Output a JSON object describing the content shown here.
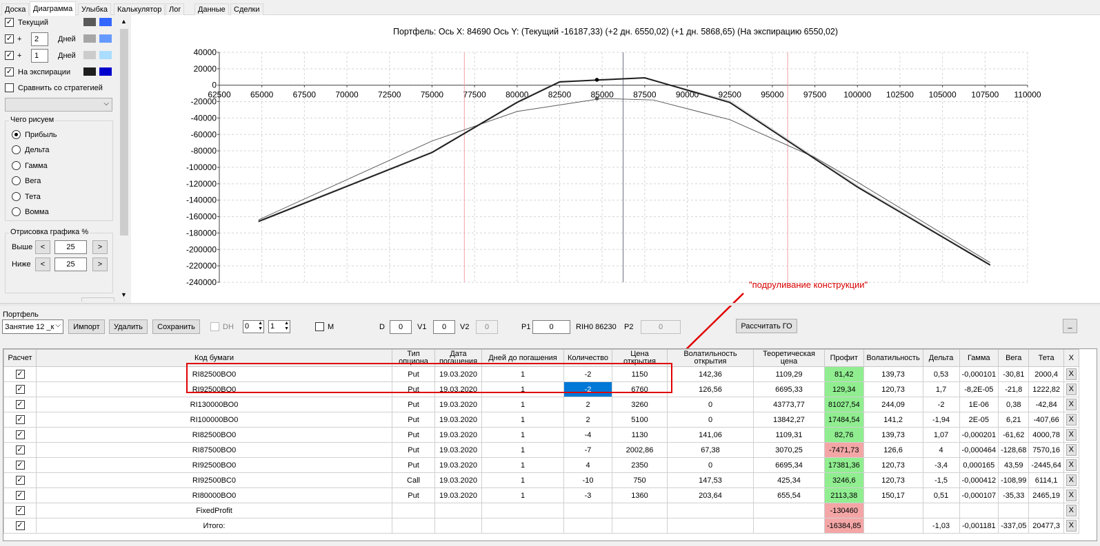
{
  "tabs": [
    "Доска",
    "Диаграмма",
    "Улыбка",
    "Калькулятор",
    "Лог",
    "Данные",
    "Сделки"
  ],
  "active_tab": "Диаграмма",
  "left": {
    "current_label": "Текущий",
    "plus": "+",
    "days": "Дней",
    "days1": "2",
    "days2": "1",
    "expiry_label": "На экспирации",
    "compare_label": "Сравнить со стратегией",
    "compare_select": "",
    "what_group": "Чего рисуем",
    "options": [
      "Прибыль",
      "Дельта",
      "Гамма",
      "Вега",
      "Тета",
      "Вомма"
    ],
    "selected_option": "Прибыль",
    "draw_group": "Отрисовка графика %",
    "above_label": "Выше",
    "below_label": "Ниже",
    "above_value": "25",
    "below_value": "25",
    "lt": "<",
    "gt": ">",
    "colors": {
      "current": [
        "#595959",
        "#3366ff"
      ],
      "plus2": [
        "#a6a6a6",
        "#6699ff"
      ],
      "plus1": [
        "#cccccc",
        "#aaddff"
      ],
      "expiry": [
        "#1f1f1f",
        "#0000cc"
      ]
    }
  },
  "chart": {
    "title": "Портфель: Ось X: 84690 Ось Y:  (Текущий -16187,33)  (+2 дн. 6550,02)  (+1 дн. 5868,65)  (На экспирацию 6550,02)",
    "annotation": "\"подруливание конструкции\""
  },
  "chart_data": {
    "type": "line",
    "xlim": [
      62500,
      110000
    ],
    "ylim": [
      -240000,
      40000
    ],
    "x_ticks": [
      62500,
      65000,
      67500,
      70000,
      72500,
      75000,
      77500,
      80000,
      82500,
      85000,
      87500,
      90000,
      92500,
      95000,
      97500,
      100000,
      102500,
      105000,
      107500,
      110000
    ],
    "x_tick_labels": [
      "62500",
      "65000",
      "67500",
      "70000",
      "72500",
      "75000",
      "77500",
      "80000",
      "82500",
      "85000",
      "87500",
      "90000",
      "92500",
      "95000",
      "97500",
      "100000",
      "102500",
      "105000",
      "107500",
      "110000"
    ],
    "y_ticks": [
      40000,
      20000,
      0,
      -20000,
      -40000,
      -60000,
      -80000,
      -100000,
      -120000,
      -140000,
      -160000,
      -180000,
      -200000,
      -220000,
      -240000
    ],
    "y_tick_labels": [
      "40000",
      "20000",
      "0",
      "-20000",
      "-40000",
      "-60000",
      "-80000",
      "-100000",
      "-120000",
      "-140000",
      "-160000",
      "-180000",
      "-200000",
      "-220000",
      "-240000"
    ],
    "vlines": {
      "current_x": 84690,
      "center": 86230,
      "lower_bound": 76900,
      "upper_bound": 95900
    },
    "series": [
      {
        "color": "#1f1f1f",
        "x": [
          64800,
          75000,
          80000,
          82500,
          85000,
          87500,
          92500,
          100000,
          107800
        ],
        "y": [
          -166000,
          -82000,
          -21000,
          4000,
          6550,
          9000,
          -21000,
          -124000,
          -219000
        ]
      },
      {
        "color": "#595959",
        "x": [
          64800,
          70000,
          75000,
          80000,
          85000,
          88000,
          92500,
          97500,
          100000,
          107800
        ],
        "y": [
          -164000,
          -115000,
          -68000,
          -32000,
          -16187,
          -18000,
          -42000,
          -88000,
          -118000,
          -216000
        ]
      },
      {
        "color": "#cccccc",
        "x": [
          64800,
          75000,
          80000,
          82500,
          85000,
          87500,
          92500,
          100000,
          107800
        ],
        "y": [
          -165000,
          -81000,
          -20000,
          5000,
          5868,
          8500,
          -19000,
          -122000,
          -218000
        ]
      }
    ],
    "markers": [
      {
        "x": 84690,
        "y": 6550
      },
      {
        "x": 84690,
        "y": -16187
      }
    ]
  },
  "toolbar": {
    "portfolio_label": "Портфель",
    "session": "Занятие 12 _к",
    "import": "Импорт",
    "delete": "Удалить",
    "save": "Сохранить",
    "dh": "DH",
    "dh_v1": "0",
    "dh_v2": "1",
    "m": "M",
    "d_label": "D",
    "d_value": "0",
    "v1_label": "V1",
    "v1_value": "0",
    "v2_label": "V2",
    "v2_value": "0",
    "p1_label": "P1",
    "p1_value": "0",
    "rih": "RIH0 86230",
    "p2_label": "P2",
    "p2_value": "0",
    "calc_go": "Рассчитать ГО",
    "min": "_"
  },
  "table": {
    "headers": [
      "Расчет",
      "Код бумаги",
      "Тип опциона",
      "Дата погашения",
      "Дней до погашения",
      "Количество",
      "Цена открытия",
      "Волатильность открытия",
      "Теоретическая цена",
      "Профит",
      "Волатильность",
      "Дельта",
      "Гамма",
      "Вега",
      "Тета",
      "X"
    ],
    "rows": [
      {
        "code": "RI82500BO0",
        "type": "Put",
        "date": "19.03.2020",
        "days": "1",
        "qty": "-2",
        "price": "1150",
        "vol_open": "142,36",
        "theo": "1109,29",
        "profit": "81,42",
        "profit_cls": "green",
        "vol": "139,73",
        "delta": "0,53",
        "gamma": "-0,000101",
        "vega": "-30,81",
        "theta": "2000,4"
      },
      {
        "code": "RI92500BO0",
        "type": "Put",
        "date": "19.03.2020",
        "days": "1",
        "qty": "-2",
        "qty_sel": true,
        "price": "6760",
        "vol_open": "126,56",
        "theo": "6695,33",
        "profit": "129,34",
        "profit_cls": "green",
        "vol": "120,73",
        "delta": "1,7",
        "gamma": "-8,2E-05",
        "vega": "-21,8",
        "theta": "1222,82"
      },
      {
        "code": "RI130000BO0",
        "type": "Put",
        "date": "19.03.2020",
        "days": "1",
        "qty": "2",
        "price": "3260",
        "vol_open": "0",
        "theo": "43773,77",
        "profit": "81027,54",
        "profit_cls": "green",
        "vol": "244,09",
        "delta": "-2",
        "gamma": "1E-06",
        "vega": "0,38",
        "theta": "-42,84"
      },
      {
        "code": "RI100000BO0",
        "type": "Put",
        "date": "19.03.2020",
        "days": "1",
        "qty": "2",
        "price": "5100",
        "vol_open": "0",
        "theo": "13842,27",
        "profit": "17484,54",
        "profit_cls": "green",
        "vol": "141,2",
        "delta": "-1,94",
        "gamma": "2E-05",
        "vega": "6,21",
        "theta": "-407,66"
      },
      {
        "code": "RI82500BO0",
        "type": "Put",
        "date": "19.03.2020",
        "days": "1",
        "qty": "-4",
        "price": "1130",
        "vol_open": "141,06",
        "theo": "1109,31",
        "profit": "82,76",
        "profit_cls": "green",
        "vol": "139,73",
        "delta": "1,07",
        "gamma": "-0,000201",
        "vega": "-61,62",
        "theta": "4000,78"
      },
      {
        "code": "RI87500BO0",
        "type": "Put",
        "date": "19.03.2020",
        "days": "1",
        "qty": "-7",
        "price": "2002,86",
        "vol_open": "67,38",
        "theo": "3070,25",
        "profit": "-7471,73",
        "profit_cls": "red",
        "vol": "126,6",
        "delta": "4",
        "gamma": "-0,000464",
        "vega": "-128,68",
        "theta": "7570,16"
      },
      {
        "code": "RI92500BO0",
        "type": "Put",
        "date": "19.03.2020",
        "days": "1",
        "qty": "4",
        "price": "2350",
        "vol_open": "0",
        "theo": "6695,34",
        "profit": "17381,36",
        "profit_cls": "green",
        "vol": "120,73",
        "delta": "-3,4",
        "gamma": "0,000165",
        "vega": "43,59",
        "theta": "-2445,64"
      },
      {
        "code": "RI92500BC0",
        "type": "Call",
        "date": "19.03.2020",
        "days": "1",
        "qty": "-10",
        "price": "750",
        "vol_open": "147,53",
        "theo": "425,34",
        "profit": "3246,6",
        "profit_cls": "green",
        "vol": "120,73",
        "delta": "-1,5",
        "gamma": "-0,000412",
        "vega": "-108,99",
        "theta": "6114,1"
      },
      {
        "code": "RI80000BO0",
        "type": "Put",
        "date": "19.03.2020",
        "days": "1",
        "qty": "-3",
        "price": "1360",
        "vol_open": "203,64",
        "theo": "655,54",
        "profit": "2113,38",
        "profit_cls": "green",
        "vol": "150,17",
        "delta": "0,51",
        "gamma": "-0,000107",
        "vega": "-35,33",
        "theta": "2465,19"
      },
      {
        "code": "FixedProfit",
        "type": "",
        "date": "",
        "days": "",
        "qty": "",
        "price": "",
        "vol_open": "",
        "theo": "",
        "profit": "-130460",
        "profit_cls": "red",
        "vol": "",
        "delta": "",
        "gamma": "",
        "vega": "",
        "theta": ""
      },
      {
        "code": "Итого:",
        "type": "",
        "date": "",
        "days": "",
        "qty": "",
        "price": "",
        "vol_open": "",
        "theo": "",
        "profit": "-16384,85",
        "profit_cls": "red",
        "vol": "",
        "delta": "-1,03",
        "gamma": "-0,001181",
        "vega": "-337,05",
        "theta": "20477,3"
      }
    ]
  }
}
